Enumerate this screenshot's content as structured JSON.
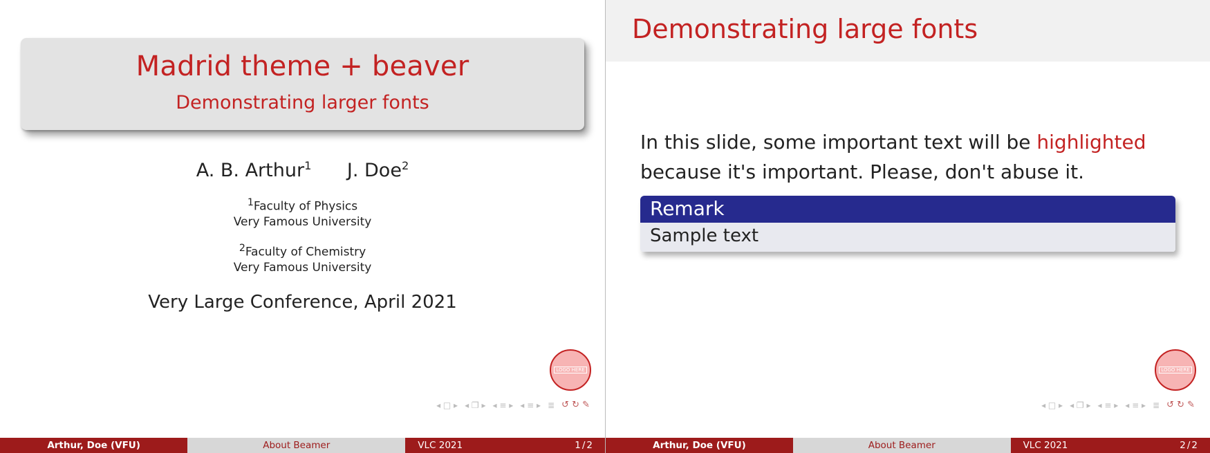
{
  "slide1": {
    "title": "Madrid theme + beaver",
    "subtitle": "Demonstrating larger fonts",
    "author1": "A. B. Arthur",
    "author1_sup": "1",
    "author2": "J. Doe",
    "author2_sup": "2",
    "aff1_sup": "1",
    "aff1_line1": "Faculty of Physics",
    "aff1_line2": "Very Famous University",
    "aff2_sup": "2",
    "aff2_line1": "Faculty of Chemistry",
    "aff2_line2": "Very Famous University",
    "conference": "Very Large Conference, April 2021",
    "logo_text": "LOGO HERE"
  },
  "slide2": {
    "frametitle": "Demonstrating large fonts",
    "body_pre": "In this slide, some important text will be ",
    "body_alert": "highlighted",
    "body_post": " because it's important. Please, don't abuse it.",
    "remark_title": "Remark",
    "remark_body": "Sample text",
    "logo_text": "LOGO HERE"
  },
  "footer": {
    "author_short": "Arthur, Doe (VFU)",
    "short_title": "About Beamer",
    "venue": "VLC 2021",
    "page1": "1",
    "page2": "2",
    "total": "2",
    "slash": "/"
  },
  "colors": {
    "accent": "#c32222",
    "footer_dark": "#9d1b1b",
    "footer_light": "#d7d7d7",
    "block_head": "#262a8e",
    "block_body": "#e8e9ef"
  }
}
